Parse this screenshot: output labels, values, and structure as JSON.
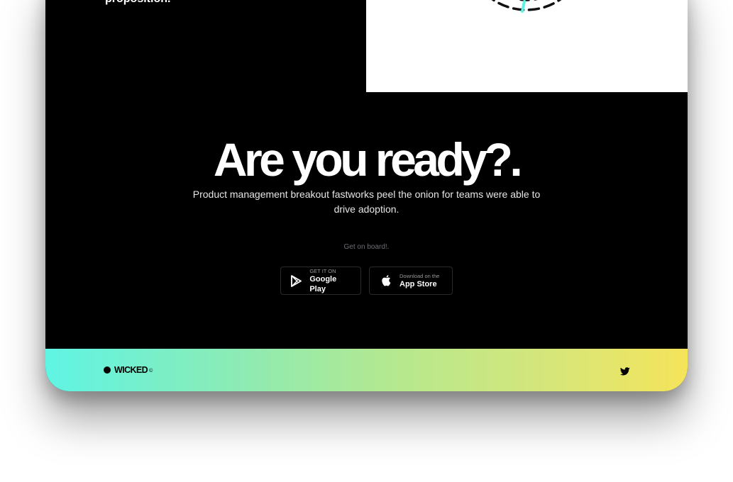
{
  "top": {
    "partial_text": "proposition."
  },
  "hero": {
    "title": "Are you ready?.",
    "subtitle": "Product management breakout fastworks peel the onion for teams were able to drive adoption.",
    "cta_label": "Get on board!."
  },
  "stores": {
    "google": {
      "small": "GET IT ON",
      "big": "Google Play",
      "icon": "google-play-icon"
    },
    "apple": {
      "small": "Download on the",
      "big": "App Store",
      "icon": "apple-icon"
    }
  },
  "footer": {
    "brand": "WICKED",
    "brand_mark": "©",
    "social_icon": "twitter-icon"
  },
  "colors": {
    "background": "#000000",
    "accent": "#5ff4e4",
    "gradient_start": "#5ff4e4",
    "gradient_end": "#f5e45a"
  }
}
